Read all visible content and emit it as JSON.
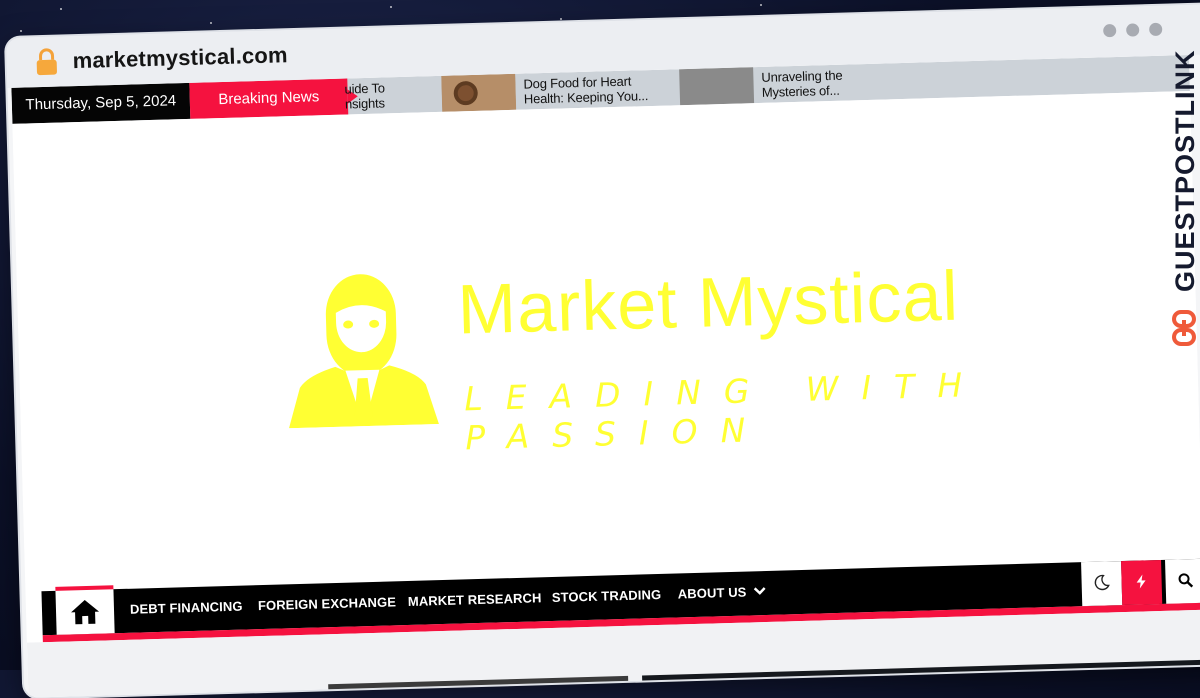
{
  "browser": {
    "url": "marketmystical.com"
  },
  "ticker": {
    "date": "Thursday, Sep 5, 2024",
    "breaking_label": "Breaking News",
    "items": [
      {
        "title_line1": "uide To",
        "title_line2": "nsights"
      },
      {
        "title_line1": "Dog Food for Heart",
        "title_line2": "Health: Keeping You..."
      },
      {
        "title_line1": "Unraveling the",
        "title_line2": "Mysteries of..."
      }
    ]
  },
  "brand": {
    "title": "Market Mystical",
    "tagline": "LEADING WITH PASSION",
    "color": "#ffff33"
  },
  "nav": {
    "items": [
      {
        "label": "DEBT FINANCING"
      },
      {
        "label": "FOREIGN EXCHANGE"
      },
      {
        "label": "MARKET RESEARCH"
      },
      {
        "label": "STOCK TRADING"
      },
      {
        "label": "ABOUT US"
      }
    ],
    "accent": "#f5123f"
  },
  "watermark": {
    "text": "GUESTPOSTLINKS",
    "icon": "chain-link-icon"
  }
}
